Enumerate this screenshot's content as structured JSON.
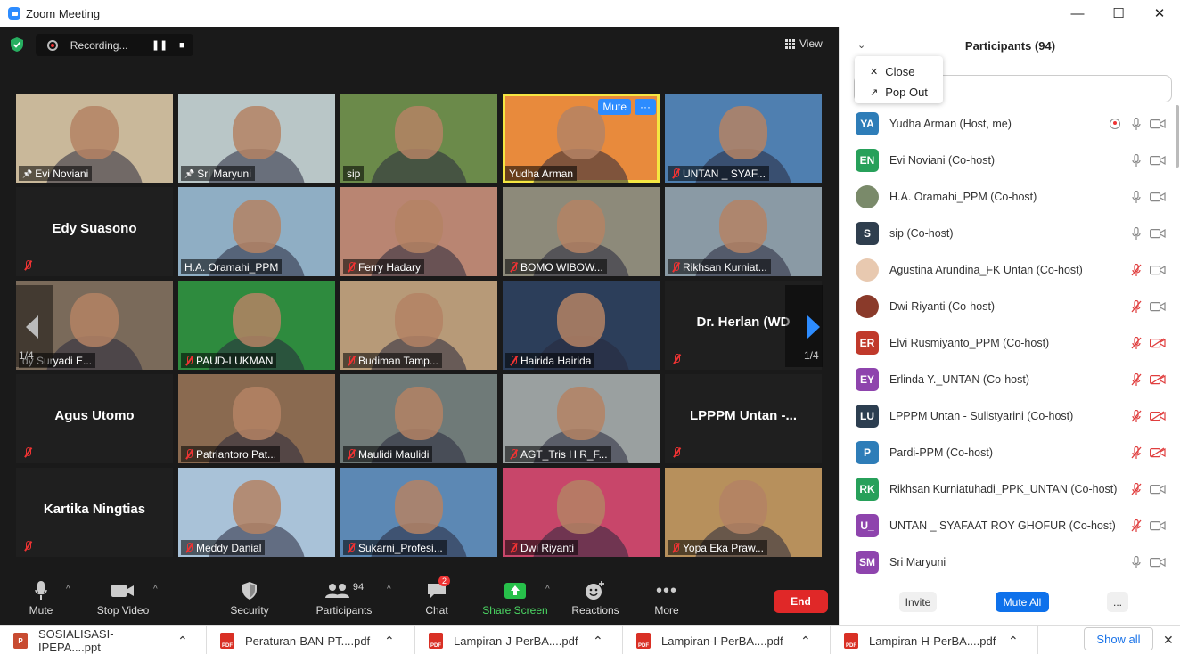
{
  "window": {
    "title": "Zoom Meeting",
    "minimize": "—",
    "maximize": "☐",
    "close": "✕"
  },
  "meeting": {
    "recording_label": "Recording...",
    "view_label": "View",
    "page_indicator": "1/4",
    "tiles": [
      {
        "name": "Evi Noviani",
        "pinned": true,
        "muted": false,
        "bg": "#c9b89a"
      },
      {
        "name": "Sri Maryuni",
        "pinned": true,
        "muted": false,
        "bg": "#b9c6c7"
      },
      {
        "name": "sip",
        "muted": false,
        "bg": "#6b8a4a"
      },
      {
        "name": "Yudha Arman",
        "muted": false,
        "bg": "#e88a3c",
        "active": true
      },
      {
        "name": "UNTAN _ SYAF...",
        "muted": true,
        "bg": "#4f7fb0"
      },
      {
        "name": "Edy Suasono",
        "muted": true,
        "bg": "#1f1f1f",
        "video": false
      },
      {
        "name": "H.A. Oramahi_PPM",
        "muted": false,
        "bg": "#8faec4"
      },
      {
        "name": "Ferry Hadary",
        "muted": true,
        "bg": "#b98572"
      },
      {
        "name": "BOMO WIBOW...",
        "muted": true,
        "bg": "#8d8a7a"
      },
      {
        "name": "Rikhsan Kurniat...",
        "muted": true,
        "bg": "#8a9aa5"
      },
      {
        "name": "dy Suryadi E...",
        "muted": false,
        "bg": "#7a6a5a"
      },
      {
        "name": "PAUD-LUKMAN",
        "muted": true,
        "bg": "#2e8b3e"
      },
      {
        "name": "Budiman Tamp...",
        "muted": true,
        "bg": "#b79a78"
      },
      {
        "name": "Hairida Hairida",
        "muted": true,
        "bg": "#2c3e5a"
      },
      {
        "name": "Dr. Herlan (WD",
        "muted": true,
        "bg": "#1f1f1f",
        "video": false
      },
      {
        "name": "Agus Utomo",
        "muted": true,
        "bg": "#1f1f1f",
        "video": false
      },
      {
        "name": "Patriantoro Pat...",
        "muted": true,
        "bg": "#8a6a50"
      },
      {
        "name": "Maulidi Maulidi",
        "muted": true,
        "bg": "#6f7a78"
      },
      {
        "name": "AGT_Tris H R_F...",
        "muted": true,
        "bg": "#9aa0a0"
      },
      {
        "name": "LPPPM Untan -...",
        "muted": true,
        "bg": "#1f1f1f",
        "video": false
      },
      {
        "name": "Kartika Ningtias",
        "muted": true,
        "bg": "#1f1f1f",
        "video": false
      },
      {
        "name": "Meddy Danial",
        "muted": true,
        "bg": "#a9c2d8"
      },
      {
        "name": "Sukarni_Profesi...",
        "muted": true,
        "bg": "#5c88b4"
      },
      {
        "name": "Dwi Riyanti",
        "muted": true,
        "bg": "#c8466a"
      },
      {
        "name": "Yopa Eka Praw...",
        "muted": true,
        "bg": "#b7905c"
      }
    ],
    "active_tile_buttons": {
      "mute": "Mute",
      "more": "···"
    }
  },
  "toolbar": {
    "mute": "Mute",
    "stop_video": "Stop Video",
    "security": "Security",
    "participants": "Participants",
    "participants_count": "94",
    "chat": "Chat",
    "chat_badge": "2",
    "share_screen": "Share Screen",
    "reactions": "Reactions",
    "more": "More",
    "end": "End"
  },
  "panel": {
    "title": "Participants (94)",
    "search_placeholder": "cipant",
    "menu": {
      "close": "Close",
      "pop_out": "Pop Out"
    },
    "participants": [
      {
        "initials": "YA",
        "color": "#2e7db8",
        "name": "Yudha Arman (Host, me)",
        "mic": "on",
        "cam": "on",
        "rec": true
      },
      {
        "initials": "EN",
        "color": "#27a05a",
        "name": "Evi Noviani (Co-host)",
        "mic": "on",
        "cam": "on"
      },
      {
        "initials": "",
        "color": "#7a8a6a",
        "name": "H.A. Oramahi_PPM (Co-host)",
        "mic": "on",
        "cam": "on"
      },
      {
        "initials": "S",
        "color": "#2f3e4e",
        "name": "sip (Co-host)",
        "mic": "on",
        "cam": "on"
      },
      {
        "initials": "",
        "color": "#e8c9b0",
        "name": "Agustina Arundina_FK Untan (Co-host)",
        "mic": "off",
        "cam": "on"
      },
      {
        "initials": "",
        "color": "#8a3a2a",
        "name": "Dwi Riyanti (Co-host)",
        "mic": "off",
        "cam": "on"
      },
      {
        "initials": "ER",
        "color": "#c0392b",
        "name": "Elvi Rusmiyanto_PPM (Co-host)",
        "mic": "off",
        "cam": "off"
      },
      {
        "initials": "EY",
        "color": "#8e44ad",
        "name": "Erlinda Y._UNTAN (Co-host)",
        "mic": "off",
        "cam": "off"
      },
      {
        "initials": "LU",
        "color": "#2c3e50",
        "name": "LPPPM Untan - Sulistyarini (Co-host)",
        "mic": "off",
        "cam": "off"
      },
      {
        "initials": "P",
        "color": "#2e7db8",
        "name": "Pardi-PPM (Co-host)",
        "mic": "off",
        "cam": "off"
      },
      {
        "initials": "RK",
        "color": "#27a05a",
        "name": "Rikhsan Kurniatuhadi_PPK_UNTAN (Co-host)",
        "mic": "off",
        "cam": "on"
      },
      {
        "initials": "U_",
        "color": "#8e44ad",
        "name": "UNTAN _ SYAFAAT ROY GHOFUR (Co-host)",
        "mic": "off",
        "cam": "on"
      },
      {
        "initials": "SM",
        "color": "#8e44ad",
        "name": "Sri Maryuni",
        "mic": "on",
        "cam": "on"
      }
    ],
    "footer": {
      "invite": "Invite",
      "mute_all": "Mute All",
      "more": "..."
    }
  },
  "downloads": {
    "items": [
      {
        "name": "SOSIALISASI-IPEPA....ppt",
        "type": "ppt"
      },
      {
        "name": "Peraturan-BAN-PT....pdf",
        "type": "pdf"
      },
      {
        "name": "Lampiran-J-PerBA....pdf",
        "type": "pdf"
      },
      {
        "name": "Lampiran-I-PerBA....pdf",
        "type": "pdf"
      },
      {
        "name": "Lampiran-H-PerBA....pdf",
        "type": "pdf"
      }
    ],
    "show_all": "Show all",
    "close": "✕"
  }
}
